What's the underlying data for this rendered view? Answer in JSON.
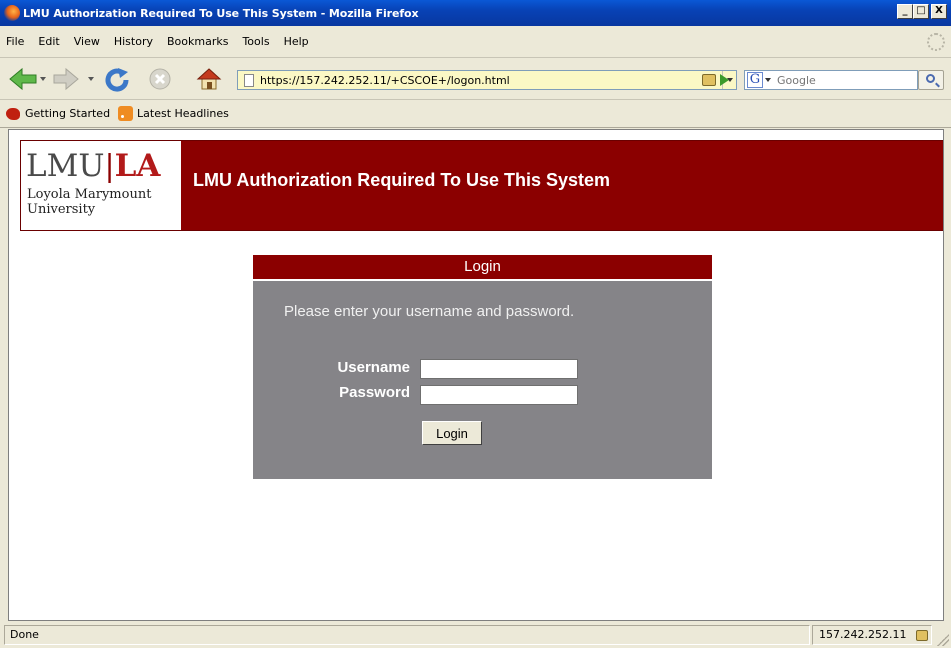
{
  "window": {
    "title": "LMU Authorization Required To Use This System - Mozilla Firefox",
    "minimize": "_",
    "maximize": "□",
    "close": "X"
  },
  "menu": {
    "items": [
      "File",
      "Edit",
      "View",
      "History",
      "Bookmarks",
      "Tools",
      "Help"
    ]
  },
  "nav": {
    "url": "https://157.242.252.11/+CSCOE+/logon.html",
    "search_placeholder": "Google",
    "search_engine_glyph": "G"
  },
  "bookmarks": {
    "items": [
      "Getting Started",
      "Latest Headlines"
    ]
  },
  "page": {
    "logo": {
      "lmu": "LMU",
      "separator": "|",
      "la": "LA",
      "line1": "Loyola Marymount",
      "line2": "University"
    },
    "banner_title": "LMU Authorization Required To Use This System",
    "login": {
      "header": "Login",
      "message": "Please enter your username and password.",
      "username_label": "Username",
      "password_label": "Password",
      "username_value": "",
      "password_value": "",
      "button_label": "Login"
    }
  },
  "status": {
    "text": "Done",
    "host": "157.242.252.11"
  },
  "colors": {
    "banner": "#8b0000",
    "login_body": "#858488",
    "address_bar": "#fbf8c5"
  }
}
